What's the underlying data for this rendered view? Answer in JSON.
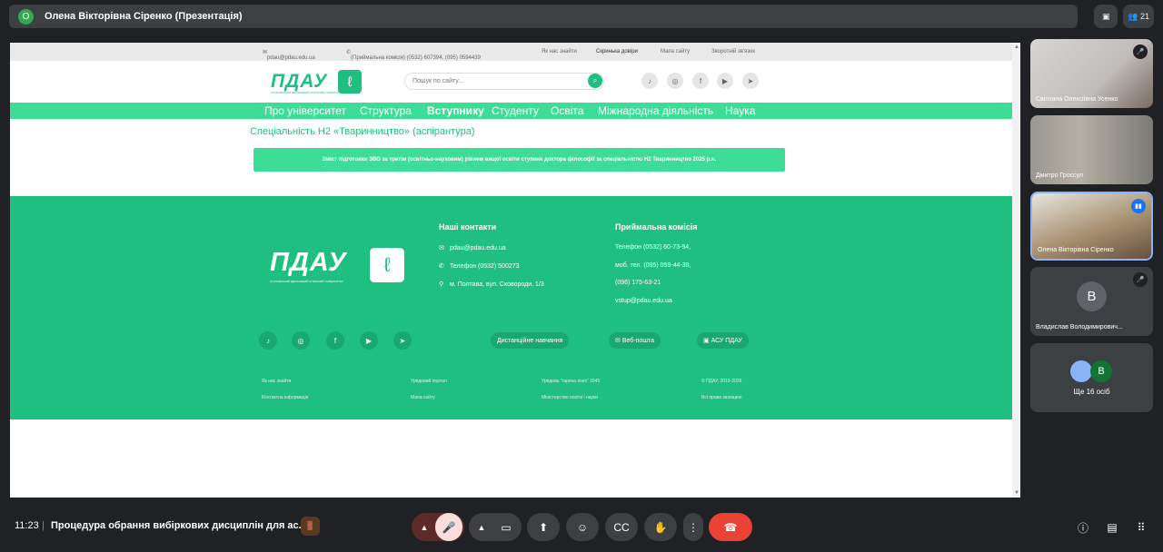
{
  "meet": {
    "presenter_title": "Олена Вікторівна Сіренко (Презентація)",
    "presenter_avatar_letter": "О",
    "participant_count": "21",
    "clock": "11:23",
    "meeting_title": "Процедура обрання вибіркових дисциплін для ас...",
    "hidden_count": "Ще 16 осіб",
    "participants": [
      {
        "name": "Світлана Олексіївна Усенко",
        "muted": true
      },
      {
        "name": "Дмитро Гроссул",
        "muted": false
      },
      {
        "name": "Олена Вікторівна Сіренко",
        "speaking": true
      },
      {
        "name": "Владислав Володимирович...",
        "letter": "В",
        "muted": true
      }
    ],
    "more_avatar_letter": "В",
    "colors": {
      "bg": "#202124",
      "hangup": "#ea4335",
      "accent": "#1fbf7f"
    }
  },
  "site": {
    "topbar": {
      "email": "pdau@pdau.edu.ua",
      "admissions_phone": "(Приймальна комісія) (0532) 607394, (095) 0594439",
      "links": [
        "Як нас знайти",
        "Скринька довіри",
        "Мапа сайту",
        "Зворотній зв'язок"
      ]
    },
    "logo_text": "ПДАУ",
    "logo_sub": "ПОЛТАВСЬКИЙ ДЕРЖАВНИЙ АГРАРНИЙ УНІВЕРСИТЕТ",
    "search_placeholder": "Пошук по сайту...",
    "nav": [
      "Про університет",
      "Структура",
      "Вступнику",
      "Студенту",
      "Освіта",
      "Міжнародна діяльність",
      "Наука"
    ],
    "heading": "Спеціальність Н2 «Тваринництво» (аспірантура)",
    "banner": "Зміст підготовки ЗВО за третім (освітньо-науковим) рівнем вищої освіти ступеня доктора філософії за спеціальністю Н2 Тваринництво 2025 р.н.",
    "footer": {
      "contacts_title": "Наші контакти",
      "contacts": [
        "pdau@pdau.edu.ua",
        "Телефон (0532) 500273",
        "м. Полтава, вул. Сковороди, 1/3"
      ],
      "admissions_title": "Приймальна комісія",
      "admissions": [
        "Телефон (0532) 60-73-94,",
        "моб. тел. (095) 059-44-39,",
        "(096) 175-63-21",
        "vstup@pdau.edu.ua"
      ],
      "buttons": [
        "Дистанційне навчання",
        "Веб-пошта",
        "АСУ ПДАУ"
      ],
      "bottom_links": [
        [
          "Як нас знайти",
          "Контактна інформація"
        ],
        [
          "Урядовий портал",
          "Мапа сайту"
        ],
        [
          "Урядова \"гаряча лінія\" 1545",
          "Міністерство освіти і науки"
        ],
        [
          "© ПДАУ, 2010-2026",
          "Всі права захищені"
        ]
      ]
    }
  }
}
